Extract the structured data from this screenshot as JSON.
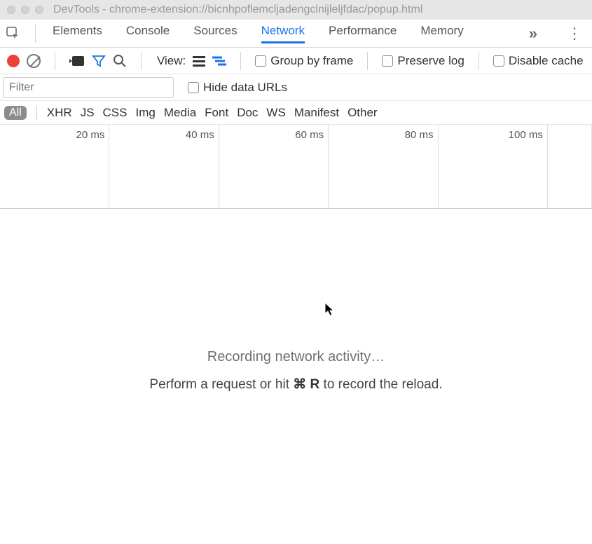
{
  "window": {
    "title": "DevTools - chrome-extension://bicnhpoflemcljadengclnijleljfdac/popup.html"
  },
  "tabs": {
    "items": [
      "Elements",
      "Console",
      "Sources",
      "Network",
      "Performance",
      "Memory"
    ],
    "active_index": 3
  },
  "toolbar": {
    "view_label": "View:",
    "group_by_frame": "Group by frame",
    "preserve_log": "Preserve log",
    "disable_cache": "Disable cache"
  },
  "filter": {
    "placeholder": "Filter",
    "hide_data_urls": "Hide data URLs"
  },
  "types": {
    "all": "All",
    "items": [
      "XHR",
      "JS",
      "CSS",
      "Img",
      "Media",
      "Font",
      "Doc",
      "WS",
      "Manifest",
      "Other"
    ]
  },
  "timeline": {
    "ticks": [
      "20 ms",
      "40 ms",
      "60 ms",
      "80 ms",
      "100 ms"
    ]
  },
  "empty": {
    "heading": "Recording network activity…",
    "line_prefix": "Perform a request or hit ",
    "line_key": "⌘ R",
    "line_suffix": " to record the reload."
  }
}
